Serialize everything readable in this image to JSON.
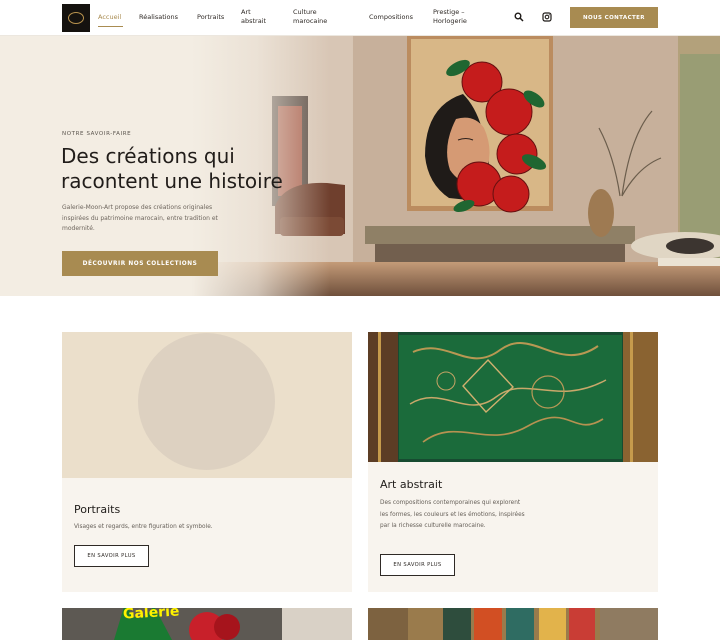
{
  "brand": {
    "logo": "logo-icon"
  },
  "nav": {
    "items": [
      {
        "label": "Accueil",
        "active": true
      },
      {
        "label": "Réalisations"
      },
      {
        "label": "Portraits"
      },
      {
        "label": "Art\nabstrait"
      },
      {
        "label": "Culture\nmarocaine"
      },
      {
        "label": "Compositions"
      },
      {
        "label": "Prestige –\nHorlogerie"
      }
    ],
    "search_icon": "search-icon",
    "instagram_icon": "instagram-icon",
    "cta": "NOUS CONTACTER"
  },
  "hero": {
    "eyebrow": "NOTRE SAVOIR-FAIRE",
    "title": "Des créations qui racontent une histoire",
    "text": "Galerie-Moon-Art propose des créations originales inspirées du patrimoine marocain, entre tradition et modernité.",
    "button": "DÉCOUVRIR NOS COLLECTIONS"
  },
  "cards": [
    {
      "title": "Portraits",
      "text": "Visages et regards, entre figuration et symbole.",
      "button": "EN SAVOIR PLUS"
    },
    {
      "title": "Art abstrait",
      "text": "Des compositions contemporaines qui explorent les formes, les couleurs et les émotions, inspirées par la richesse culturelle marocaine.",
      "button": "EN SAVOIR PLUS"
    }
  ],
  "bottom_cards": [
    {
      "partial_text": "Galerie"
    },
    {}
  ],
  "colors": {
    "accent": "#a88b51",
    "cream": "#f8f4ee",
    "hero": "#f2ece2"
  }
}
